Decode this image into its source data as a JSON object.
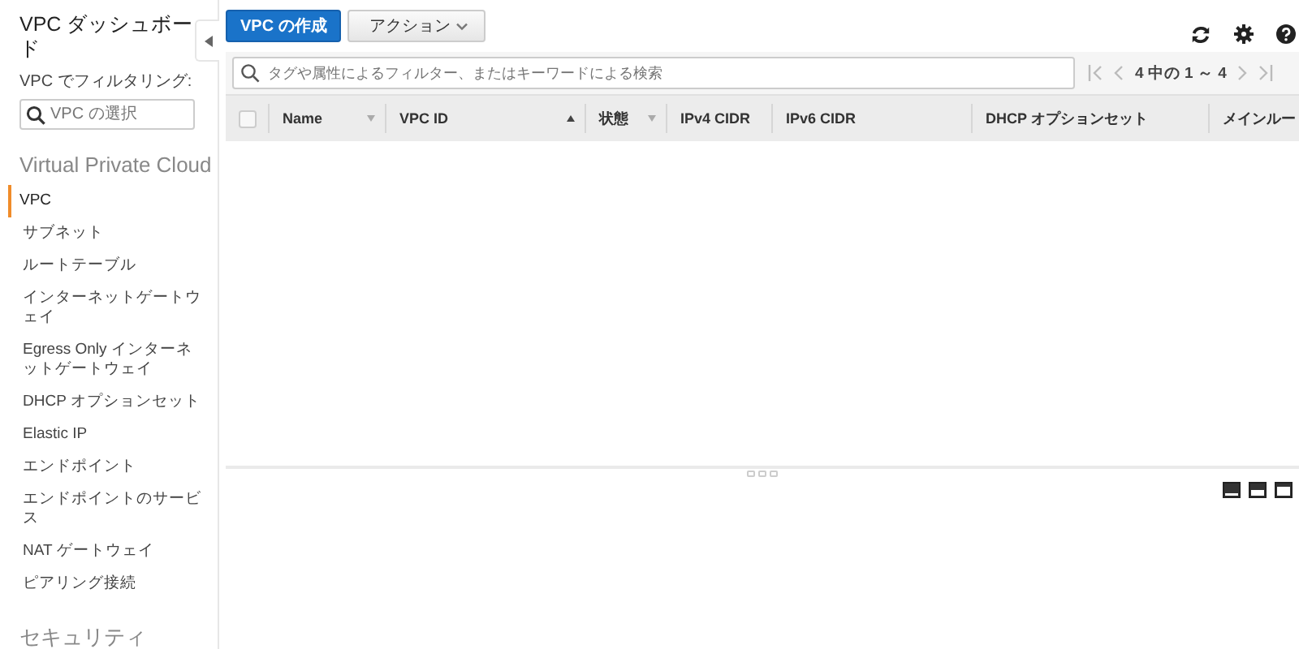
{
  "sidebar": {
    "title": "VPC ダッシュボード",
    "filter_label": "VPC でフィルタリング:",
    "filter": {
      "placeholder": "VPC の選択"
    },
    "sections": [
      {
        "heading": "Virtual Private Cloud",
        "items": [
          {
            "label": "VPC",
            "selected": true
          },
          {
            "label": "サブネット",
            "selected": false
          },
          {
            "label": "ルートテーブル",
            "selected": false
          },
          {
            "label": "インターネットゲートウェイ",
            "selected": false
          },
          {
            "label": "Egress Only インターネットゲートウェイ",
            "selected": false
          },
          {
            "label": "DHCP オプションセット",
            "selected": false
          },
          {
            "label": "Elastic IP",
            "selected": false
          },
          {
            "label": "エンドポイント",
            "selected": false
          },
          {
            "label": "エンドポイントのサービス",
            "selected": false
          },
          {
            "label": "NAT ゲートウェイ",
            "selected": false
          },
          {
            "label": "ピアリング接続",
            "selected": false
          }
        ]
      },
      {
        "heading": "セキュリティ"
      }
    ]
  },
  "toolbar": {
    "buttons": [
      {
        "label": "VPC の作成",
        "kind": "primary"
      },
      {
        "label": "アクション",
        "kind": "menu"
      }
    ]
  },
  "search": {
    "placeholder": "タグや属性によるフィルター、またはキーワードによる検索"
  },
  "pagination": {
    "text": "4 中の 1 ～ 4"
  },
  "table": {
    "select_all": {
      "checked": false
    },
    "columns": [
      {
        "label": "Name",
        "sorted": false
      },
      {
        "label": "VPC ID",
        "sorted": true
      },
      {
        "label": "状態",
        "sorted": false
      },
      {
        "label": "IPv4 CIDR"
      },
      {
        "label": "IPv6 CIDR"
      },
      {
        "label": "DHCP オプションセット"
      },
      {
        "label": "メインルー"
      }
    ]
  }
}
